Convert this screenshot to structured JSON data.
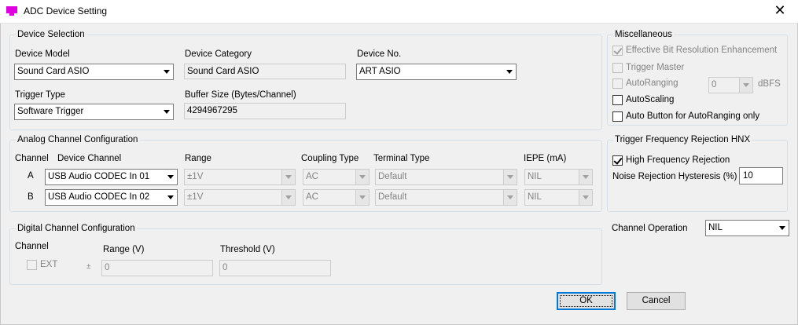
{
  "window": {
    "title": "ADC Device Setting",
    "close_glyph": "✕"
  },
  "device_selection": {
    "title": "Device Selection",
    "device_model_label": "Device Model",
    "device_model_value": "Sound Card ASIO",
    "device_category_label": "Device Category",
    "device_category_value": "Sound Card ASIO",
    "device_no_label": "Device No.",
    "device_no_value": "ART ASIO",
    "trigger_type_label": "Trigger Type",
    "trigger_type_value": "Software Trigger",
    "buffer_size_label": "Buffer Size (Bytes/Channel)",
    "buffer_size_value": "4294967295"
  },
  "analog": {
    "title": "Analog Channel Configuration",
    "headers": {
      "channel": "Channel",
      "device_channel": "Device Channel",
      "range": "Range",
      "coupling": "Coupling Type",
      "terminal": "Terminal Type",
      "iepe": "IEPE (mA)"
    },
    "rows": [
      {
        "channel": "A",
        "device_channel": "USB Audio CODEC In 01",
        "range": "±1V",
        "coupling": "AC",
        "terminal": "Default",
        "iepe": "NIL"
      },
      {
        "channel": "B",
        "device_channel": "USB Audio CODEC In 02",
        "range": "±1V",
        "coupling": "AC",
        "terminal": "Default",
        "iepe": "NIL"
      }
    ]
  },
  "digital": {
    "title": "Digital Channel Configuration",
    "channel_label": "Channel",
    "ext_label": "EXT",
    "pm_symbol": "±",
    "range_label": "Range (V)",
    "range_value": "0",
    "threshold_label": "Threshold (V)",
    "threshold_value": "0"
  },
  "misc": {
    "title": "Miscellaneous",
    "effective_bit": "Effective Bit Resolution Enhancement",
    "trigger_master": "Trigger Master",
    "auto_ranging": "AutoRanging",
    "auto_ranging_value": "0",
    "dbfs_label": "dBFS",
    "auto_scaling": "AutoScaling",
    "auto_button": "Auto Button for AutoRanging only"
  },
  "trigger_rejection": {
    "title": "Trigger Frequency Rejection HNX",
    "high_freq": "High Frequency Rejection",
    "hysteresis_label": "Noise Rejection Hysteresis (%)",
    "hysteresis_value": "10"
  },
  "channel_operation": {
    "label": "Channel Operation",
    "value": "NIL"
  },
  "buttons": {
    "ok": "OK",
    "cancel": "Cancel"
  }
}
